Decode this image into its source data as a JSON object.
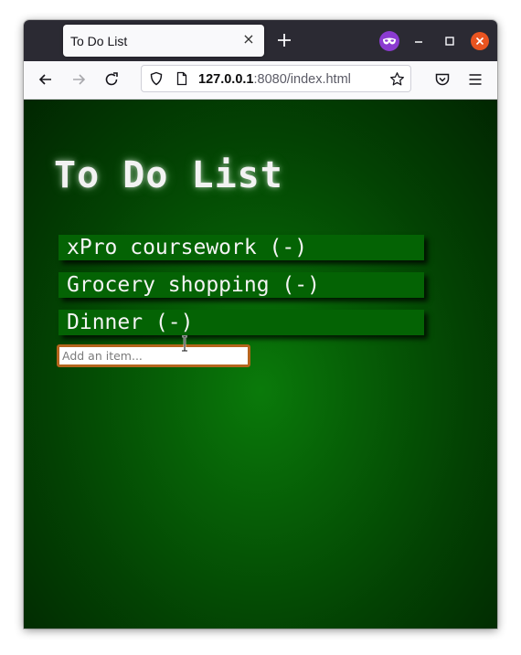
{
  "browser": {
    "tab_title": "To Do List",
    "tab_close": "×",
    "url_host": "127.0.0.1",
    "url_rest": ":8080/index.html"
  },
  "page": {
    "title": "To Do List",
    "items": [
      {
        "label": "xPro coursework (-)"
      },
      {
        "label": "Grocery shopping (-)"
      },
      {
        "label": "Dinner (-)"
      }
    ],
    "input_placeholder": "Add an item..."
  },
  "colors": {
    "accent_border": "#b5651d",
    "item_bg": "#046304",
    "private_mask": "#8b3bd0",
    "close_button": "#e95420"
  },
  "icons": [
    "new-tab-plus-icon",
    "private-browsing-mask-icon",
    "minimize-icon",
    "maximize-icon",
    "window-close-icon",
    "back-arrow-icon",
    "forward-arrow-icon",
    "reload-icon",
    "shield-icon",
    "page-icon",
    "bookmark-star-icon",
    "pocket-icon",
    "hamburger-menu-icon",
    "text-cursor-icon"
  ]
}
